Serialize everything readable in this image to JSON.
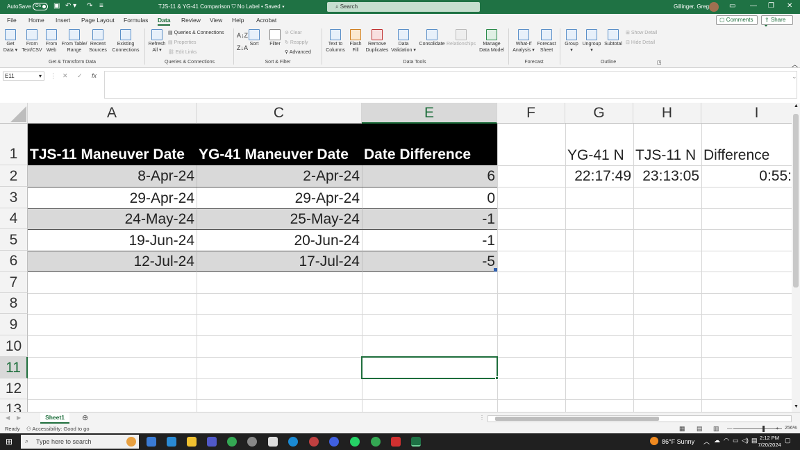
{
  "titlebar": {
    "autosave_label": "AutoSave",
    "autosave_state": "On",
    "doc_title": "TJS-11 & YG-41 Comparison",
    "label_status": "No Label • Saved",
    "search_placeholder": "Search",
    "user_name": "Gillinger, Greg"
  },
  "tabs": [
    "File",
    "Home",
    "Insert",
    "Page Layout",
    "Formulas",
    "Data",
    "Review",
    "View",
    "Help",
    "Acrobat"
  ],
  "active_tab": "Data",
  "comments_label": "Comments",
  "share_label": "Share",
  "ribbon": {
    "get_data": [
      "Get",
      "Data ▾"
    ],
    "from_text": [
      "From",
      "Text/CSV"
    ],
    "from_web": [
      "From",
      "Web"
    ],
    "from_table": [
      "From Table/",
      "Range"
    ],
    "recent_sources": [
      "Recent",
      "Sources"
    ],
    "existing_connections": [
      "Existing",
      "Connections"
    ],
    "group_get_transform": "Get & Transform Data",
    "refresh_all": [
      "Refresh",
      "All ▾"
    ],
    "queries_connections": "Queries & Connections",
    "properties": "Properties",
    "edit_links": "Edit Links",
    "group_queries": "Queries & Connections",
    "sort": "Sort",
    "filter": "Filter",
    "clear": "Clear",
    "reapply": "Reapply",
    "advanced": "Advanced",
    "group_sort_filter": "Sort & Filter",
    "text_to_columns": [
      "Text to",
      "Columns"
    ],
    "flash_fill": [
      "Flash",
      "Fill"
    ],
    "remove_duplicates": [
      "Remove",
      "Duplicates"
    ],
    "data_validation": [
      "Data",
      "Validation ▾"
    ],
    "consolidate": "Consolidate",
    "relationships": "Relationships",
    "manage_data_model": [
      "Manage",
      "Data Model"
    ],
    "group_data_tools": "Data Tools",
    "what_if": [
      "What-If",
      "Analysis ▾"
    ],
    "forecast_sheet": [
      "Forecast",
      "Sheet"
    ],
    "group_forecast": "Forecast",
    "group": [
      "Group",
      "▾"
    ],
    "ungroup": [
      "Ungroup",
      "▾"
    ],
    "subtotal": "Subtotal",
    "show_detail": "Show Detail",
    "hide_detail": "Hide Detail",
    "group_outline": "Outline"
  },
  "name_box": "E11",
  "formula_content": "",
  "columns": [
    "A",
    "C",
    "E",
    "F",
    "G",
    "H",
    "I"
  ],
  "rows": [
    "1",
    "2",
    "3",
    "4",
    "5",
    "6",
    "7",
    "8",
    "9",
    "10",
    "11",
    "12",
    "13"
  ],
  "headers": [
    "TJS-11 Maneuver Date",
    "YG-41 Maneuver Date",
    "Date Difference"
  ],
  "table_rows": [
    [
      "8-Apr-24",
      "2-Apr-24",
      "6"
    ],
    [
      "29-Apr-24",
      "29-Apr-24",
      "0"
    ],
    [
      "24-May-24",
      "25-May-24",
      "-1"
    ],
    [
      "19-Jun-24",
      "20-Jun-24",
      "-1"
    ],
    [
      "12-Jul-24",
      "17-Jul-24",
      "-5"
    ]
  ],
  "side_headers": [
    "YG-41 N",
    "TJS-11 N",
    "Difference"
  ],
  "side_values": [
    "22:17:49",
    "23:13:05",
    "0:55:"
  ],
  "sheet_tab": "Sheet1",
  "status": {
    "ready": "Ready",
    "accessibility": "Accessibility: Good to go",
    "zoom": "256%"
  },
  "taskbar": {
    "search_placeholder": "Type here to search",
    "weather": "86°F  Sunny",
    "time": "2:12 PM",
    "date": "7/20/2024"
  }
}
